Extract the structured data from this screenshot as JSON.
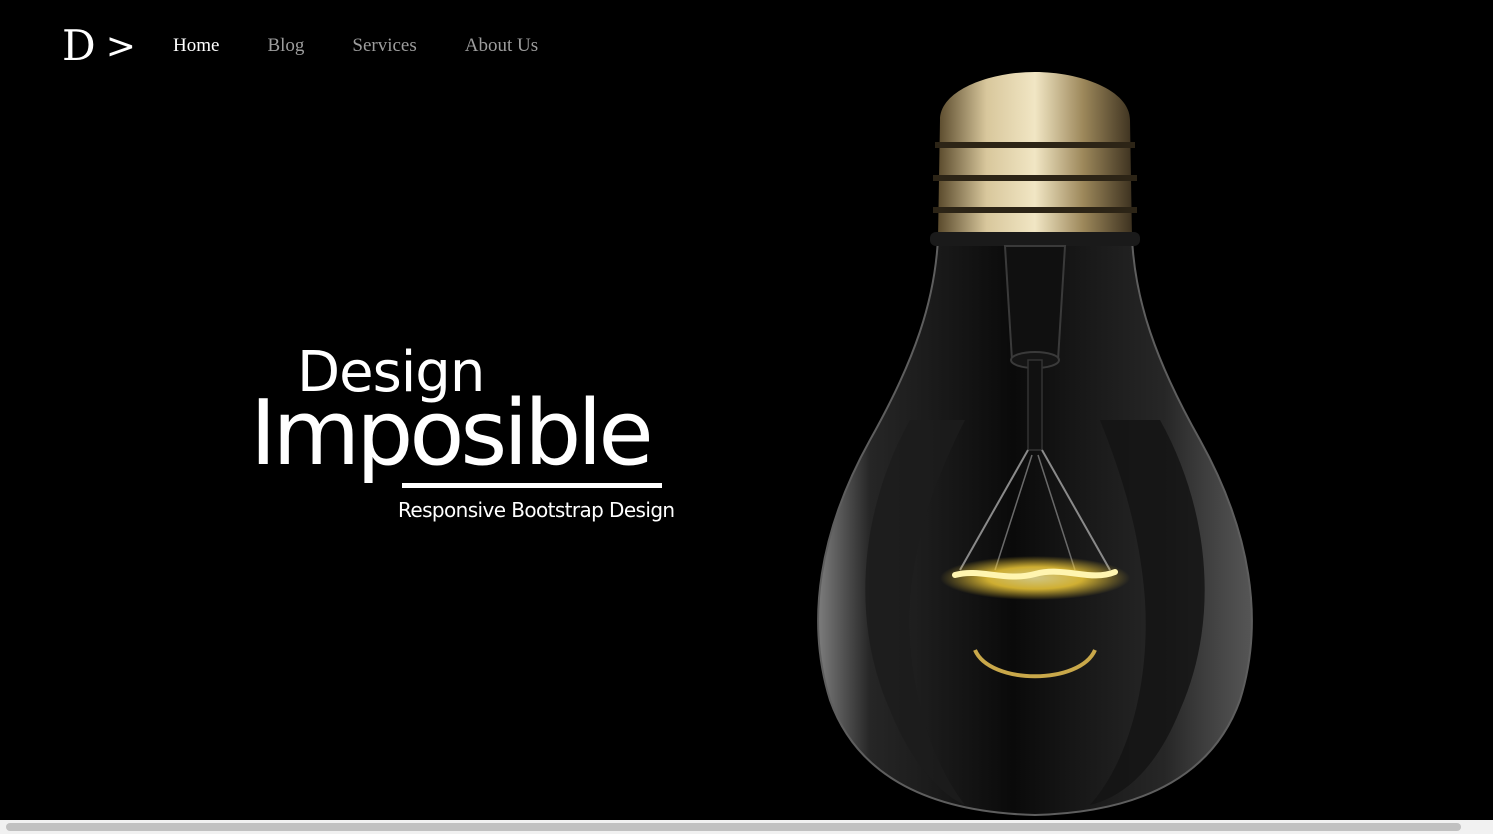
{
  "brand": {
    "letter": "D",
    "arrow": ">"
  },
  "nav": {
    "items": [
      {
        "label": "Home",
        "active": true
      },
      {
        "label": "Blog",
        "active": false
      },
      {
        "label": "Services",
        "active": false
      },
      {
        "label": "About Us",
        "active": false
      }
    ]
  },
  "hero": {
    "line1": "Design",
    "line2": "Imposible",
    "tagline": "Responsive Bootstrap Design"
  },
  "media": {
    "bulb_icon": "light-bulb-icon",
    "filament_color": "#ffd63a"
  },
  "colors": {
    "background": "#000000",
    "nav_active": "#ffffff",
    "nav_inactive": "#9d9d9d"
  }
}
